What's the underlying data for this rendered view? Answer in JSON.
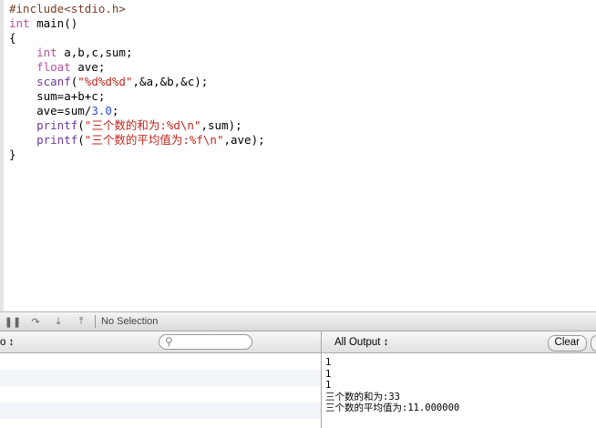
{
  "code": {
    "l1a": "#include",
    "l1b": "<stdio.h>",
    "l2a": "int",
    "l2b": " main()",
    "l3": "{",
    "l4a": "    int",
    "l4b": " a,b,c,sum;",
    "l5a": "    float",
    "l5b": " ave;",
    "l6a": "    scanf",
    "l6b": "(",
    "l6c": "\"%d%d%d\"",
    "l6d": ",&a,&b,&c);",
    "l7": "    sum=a+b+c;",
    "l8a": "    ave=sum/",
    "l8b": "3.0",
    "l8c": ";",
    "l9a": "    printf",
    "l9b": "(",
    "l9c": "\"三个数的和为:%d\\n\"",
    "l9d": ",sum);",
    "l10a": "    printf",
    "l10b": "(",
    "l10c": "\"三个数的平均值为:%f\\n\"",
    "l10d": ",ave);",
    "l11": "}"
  },
  "debugbar": {
    "selection": "No Selection"
  },
  "variables": {
    "scope_label": "o ↕",
    "search_placeholder": ""
  },
  "console": {
    "filter": "All Output ↕",
    "clear": "Clear",
    "lines": [
      "1",
      "1",
      "1",
      "三个数的和为:33",
      "三个数的平均值为:11.000000"
    ]
  }
}
